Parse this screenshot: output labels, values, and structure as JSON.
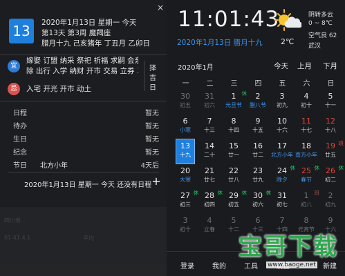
{
  "left": {
    "close_label": "×",
    "day_number": "13",
    "info_lines": [
      "2020年1月13日 星期一 今天",
      "第13天 第3周 魔羯座",
      "腊月十九 己亥猪年 丁丑月 乙卯日"
    ],
    "yi": {
      "label": "宜",
      "text_line1": "嫁娶 订盟 纳采 祭祀 祈福 求嗣 会亲友 解",
      "text_line2": "除 出行 入学 纳财 开市 交易 立券 习艺..."
    },
    "ji": {
      "label": "忌",
      "text": "入宅 开光 开市 动土"
    },
    "zeji_label": "择吉日",
    "schedule": [
      {
        "label": "日程",
        "value": "",
        "right": "暂无"
      },
      {
        "label": "待办",
        "value": "",
        "right": "暂无"
      },
      {
        "label": "生日",
        "value": "",
        "right": "暂无"
      },
      {
        "label": "纪念",
        "value": "",
        "right": "暂无"
      },
      {
        "label": "节日",
        "value": "北方小年",
        "right": "4天后"
      }
    ],
    "summary": "2020年1月13日 星期一 今天 还没有日程",
    "add_label": "+",
    "bg_doc_rows": [
      "四川省...",
      "01 41 4.1",
      "平均"
    ]
  },
  "right": {
    "clock": "11:01:43",
    "lunar_date": "2020年1月13日 腊月十九",
    "weather": {
      "icon": "partly-sunny-icon",
      "temp": "2℃",
      "condition": "阴转多云",
      "range": "0 ~ 8℃",
      "aqi": "空气良 62",
      "city": "武汉"
    },
    "month_label": "2020年1月",
    "nav": {
      "today": "今天",
      "prev": "上月",
      "next": "下月"
    },
    "weekdays": [
      "一",
      "二",
      "三",
      "四",
      "五",
      "六",
      "日"
    ],
    "weeks": [
      [
        {
          "n": "30",
          "s": "初五",
          "dim": true
        },
        {
          "n": "31",
          "s": "初六",
          "dim": true
        },
        {
          "n": "1",
          "s": "元旦节",
          "b": "休",
          "sc": "blue"
        },
        {
          "n": "2",
          "s": "腊八节",
          "sc": "blue"
        },
        {
          "n": "3",
          "s": "初九"
        },
        {
          "n": "4",
          "s": "初十"
        },
        {
          "n": "5",
          "s": "十一"
        }
      ],
      [
        {
          "n": "6",
          "s": "小寒",
          "sc": "blue"
        },
        {
          "n": "7",
          "s": "十三"
        },
        {
          "n": "8",
          "s": "十四"
        },
        {
          "n": "9",
          "s": "十五"
        },
        {
          "n": "10",
          "s": "十六"
        },
        {
          "n": "11",
          "s": "十七",
          "nc": "red"
        },
        {
          "n": "12",
          "s": "十八",
          "nc": "red"
        }
      ],
      [
        {
          "n": "13",
          "s": "十九",
          "today": true
        },
        {
          "n": "14",
          "s": "二十"
        },
        {
          "n": "15",
          "s": "廿一"
        },
        {
          "n": "16",
          "s": "廿二"
        },
        {
          "n": "17",
          "s": "北方小年",
          "sc": "blue"
        },
        {
          "n": "18",
          "s": "南方小年",
          "sc": "blue"
        },
        {
          "n": "19",
          "s": "廿五",
          "b": "班",
          "bc": "red",
          "nc": "red"
        }
      ],
      [
        {
          "n": "20",
          "s": "大寒",
          "sc": "blue"
        },
        {
          "n": "21",
          "s": "廿七"
        },
        {
          "n": "22",
          "s": "廿八"
        },
        {
          "n": "23",
          "s": "廿九"
        },
        {
          "n": "24",
          "s": "除夕",
          "b": "休",
          "sc": "blue"
        },
        {
          "n": "25",
          "s": "春节",
          "b": "休",
          "sc": "blue",
          "nc": "red"
        },
        {
          "n": "26",
          "s": "初二",
          "b": "休",
          "nc": "red"
        }
      ],
      [
        {
          "n": "27",
          "s": "初三",
          "b": "休"
        },
        {
          "n": "28",
          "s": "初四",
          "b": "休"
        },
        {
          "n": "29",
          "s": "初五",
          "b": "休"
        },
        {
          "n": "30",
          "s": "初六",
          "b": "休"
        },
        {
          "n": "31",
          "s": "初七"
        },
        {
          "n": "1",
          "s": "初八",
          "b": "班",
          "bc": "red",
          "dim": true
        },
        {
          "n": "2",
          "s": "初九",
          "dim": true
        }
      ],
      [
        {
          "n": "3",
          "s": "初十",
          "dim": true
        },
        {
          "n": "4",
          "s": "立春",
          "dim": true
        },
        {
          "n": "5",
          "s": "十二",
          "dim": true
        },
        {
          "n": "6",
          "s": "十三",
          "dim": true
        },
        {
          "n": "7",
          "s": "十四",
          "dim": true
        },
        {
          "n": "8",
          "s": "元宵节",
          "dim": true
        },
        {
          "n": "9",
          "s": "十六",
          "dim": true
        }
      ]
    ],
    "footer": [
      "登录",
      "我的",
      "工具",
      "设置",
      "新建"
    ]
  },
  "watermark": {
    "text": "宝哥下载",
    "url": "www.baoge.net"
  },
  "colors": {
    "accent": "#1e7fdc",
    "red": "#e0473d",
    "green": "#33c46a",
    "blue_text": "#3d95ee"
  }
}
